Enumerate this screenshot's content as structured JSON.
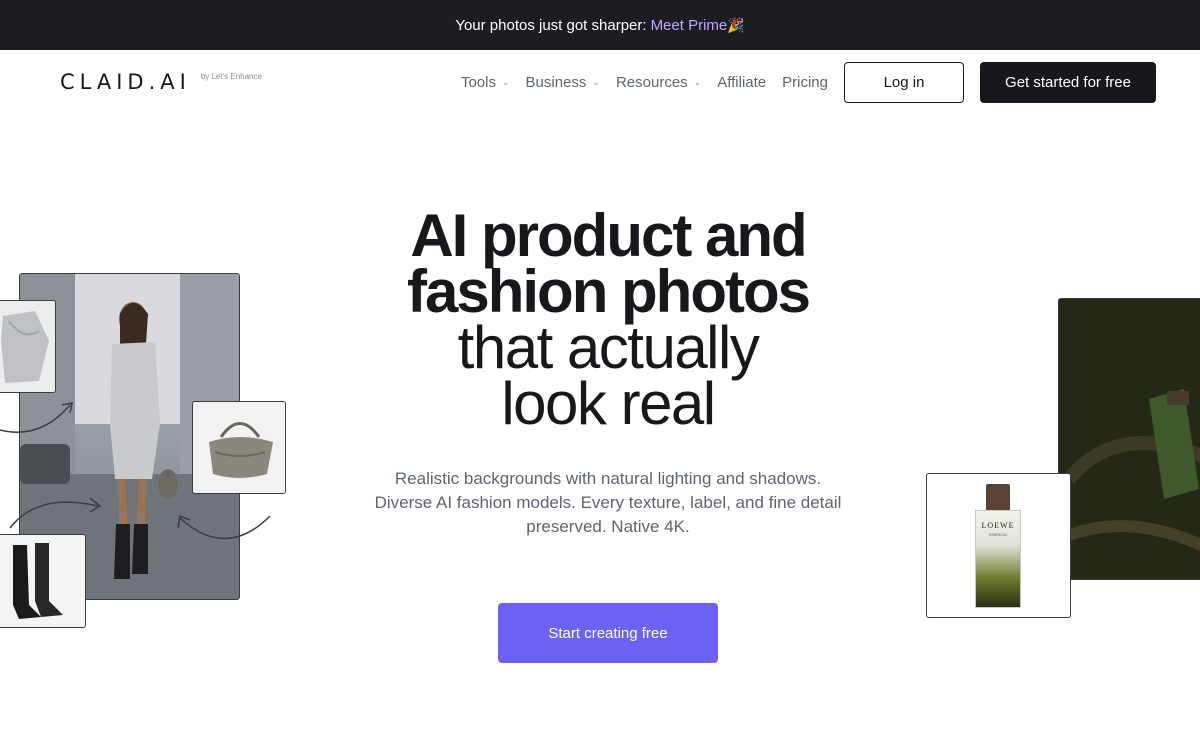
{
  "announcement": {
    "text": "Your photos just got sharper:",
    "link": "Meet Prime",
    "emoji": "🎉"
  },
  "header": {
    "logo": "CLAID.AI",
    "byline": "by Let's Enhance",
    "nav": [
      {
        "label": "Tools",
        "has_dropdown": true
      },
      {
        "label": "Business",
        "has_dropdown": true
      },
      {
        "label": "Resources",
        "has_dropdown": true
      },
      {
        "label": "Affiliate",
        "has_dropdown": false
      },
      {
        "label": "Pricing",
        "has_dropdown": false
      }
    ],
    "login": "Log in",
    "cta": "Get started for free"
  },
  "hero": {
    "title_bold_1": "AI product and",
    "title_bold_2": "fashion photos",
    "title_light_1": "that actually",
    "title_light_2": "look real",
    "subtitle": "Realistic backgrounds with natural lighting and shadows. Diverse AI fashion models. Every texture, label, and fine detail preserved. Native 4K.",
    "button": "Start creating free"
  },
  "perfume": {
    "brand": "LOEWE",
    "line": "ESENCIA"
  },
  "colors": {
    "announce_bg": "#1c1d22",
    "link_purple": "#c4a6ff",
    "primary": "#6c63f5",
    "dark": "#17171c",
    "muted_text": "#5f6470"
  }
}
